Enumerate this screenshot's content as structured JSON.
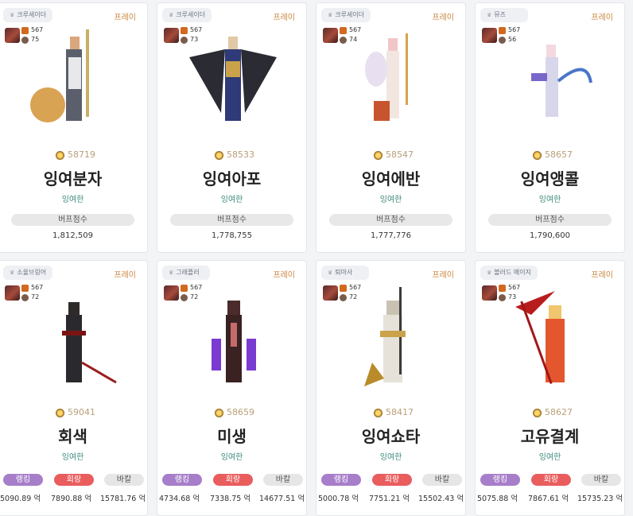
{
  "server_label": "프레이",
  "score_label": "버프점수",
  "pill_labels": [
    "랭킹",
    "회랑",
    "바칼"
  ],
  "cards": [
    {
      "class": "크루세이더",
      "level": "567",
      "sub": "75",
      "fame": "58719",
      "name": "잉여분자",
      "guild": "잉여한",
      "score": "1,812,509"
    },
    {
      "class": "크루세이더",
      "level": "567",
      "sub": "73",
      "fame": "58533",
      "name": "잉여아포",
      "guild": "잉여한",
      "score": "1,778,755"
    },
    {
      "class": "크루세이더",
      "level": "567",
      "sub": "74",
      "fame": "58547",
      "name": "잉여에반",
      "guild": "잉여한",
      "score": "1,777,776"
    },
    {
      "class": "뮤즈",
      "level": "567",
      "sub": "56",
      "fame": "58657",
      "name": "잉여앵콜",
      "guild": "잉여한",
      "score": "1,790,600"
    },
    {
      "class": "소울브링어",
      "level": "567",
      "sub": "72",
      "fame": "59041",
      "name": "회색",
      "guild": "잉여한",
      "v1": "5090.89 억",
      "v2": "7890.88 억",
      "v3": "15781.76 억"
    },
    {
      "class": "그래플러",
      "level": "567",
      "sub": "72",
      "fame": "58659",
      "name": "미생",
      "guild": "잉여한",
      "v1": "4734.68 억",
      "v2": "7338.75 억",
      "v3": "14677.51 억"
    },
    {
      "class": "퇴마사",
      "level": "567",
      "sub": "72",
      "fame": "58417",
      "name": "잉여쇼타",
      "guild": "잉여한",
      "v1": "5000.78 억",
      "v2": "7751.21 억",
      "v3": "15502.43 억"
    },
    {
      "class": "블러드 메이지",
      "level": "567",
      "sub": "73",
      "fame": "58627",
      "name": "고유결계",
      "guild": "잉여한",
      "v1": "5075.88 억",
      "v2": "7867.61 억",
      "v3": "15735.23 억"
    }
  ]
}
